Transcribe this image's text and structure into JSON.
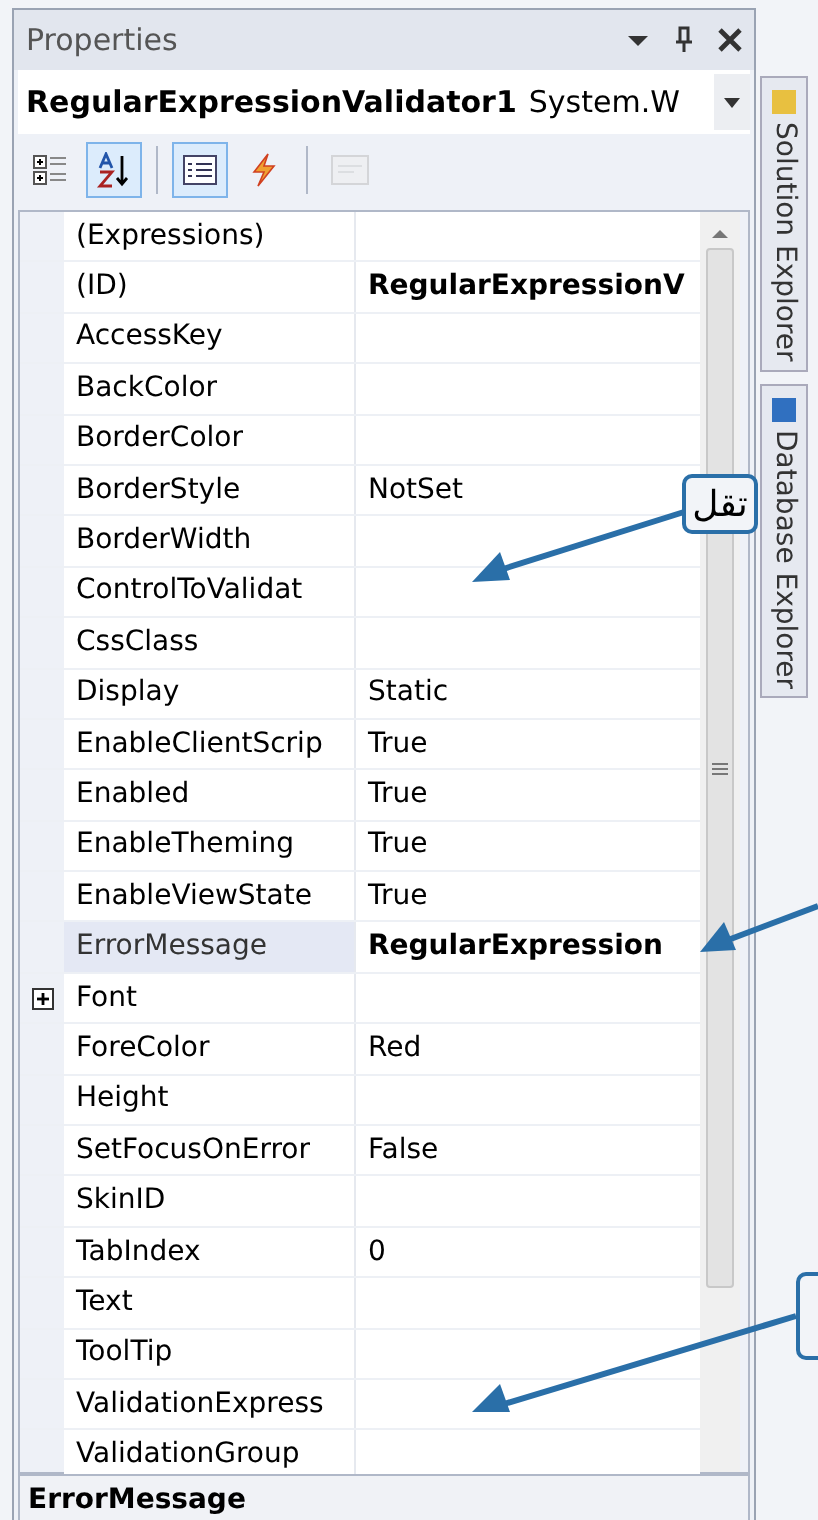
{
  "panel": {
    "title": "Properties",
    "object_selector": {
      "name": "RegularExpressionValidator1",
      "type": "System.W"
    },
    "toolbar": [
      {
        "kind": "categorized",
        "selected": false,
        "disabled": false
      },
      {
        "kind": "alphabetical",
        "selected": true,
        "disabled": false
      },
      {
        "kind": "properties",
        "selected": true,
        "disabled": false
      },
      {
        "kind": "events",
        "selected": false,
        "disabled": false
      },
      {
        "kind": "property_pages",
        "selected": false,
        "disabled": true
      }
    ],
    "properties": [
      {
        "name": "(Expressions)",
        "selected": false
      },
      {
        "name": "(ID)",
        "value": "RegularExpressionV",
        "bold": true,
        "selected": false
      },
      {
        "name": "AccessKey",
        "selected": false
      },
      {
        "name": "BackColor",
        "selected": false
      },
      {
        "name": "BorderColor",
        "selected": false
      },
      {
        "name": "BorderStyle",
        "value": "NotSet",
        "bold": false,
        "selected": false
      },
      {
        "name": "BorderWidth",
        "selected": false
      },
      {
        "name": "ControlToValidat",
        "selected": false
      },
      {
        "name": "CssClass",
        "selected": false
      },
      {
        "name": "Display",
        "value": "Static",
        "bold": false,
        "selected": false
      },
      {
        "name": "EnableClientScrip",
        "value": "True",
        "bold": false,
        "selected": false
      },
      {
        "name": "Enabled",
        "value": "True",
        "bold": false,
        "selected": false
      },
      {
        "name": "EnableTheming",
        "value": "True",
        "bold": false,
        "selected": false
      },
      {
        "name": "EnableViewState",
        "value": "True",
        "bold": false,
        "selected": false
      },
      {
        "name": "ErrorMessage",
        "value": "RegularExpression",
        "bold": true,
        "selected": true
      },
      {
        "name": "Font",
        "selected": false,
        "expanded": false
      },
      {
        "name": "ForeColor",
        "value": "Red",
        "bold": false,
        "selected": false
      },
      {
        "name": "Height",
        "selected": false
      },
      {
        "name": "SetFocusOnError",
        "value": "False",
        "bold": false,
        "selected": false
      },
      {
        "name": "SkinID",
        "selected": false
      },
      {
        "name": "TabIndex",
        "value": "0",
        "bold": false,
        "selected": false
      },
      {
        "name": "Text",
        "selected": false
      },
      {
        "name": "ToolTip",
        "selected": false
      },
      {
        "name": "ValidationExpress",
        "selected": false
      },
      {
        "name": "ValidationGroup",
        "selected": false
      }
    ],
    "description": "ErrorMessage"
  },
  "side_tabs": [
    {
      "label": "Solution Explorer"
    },
    {
      "label": "Database Explorer"
    }
  ],
  "callouts": [
    {
      "text": "تقل"
    }
  ]
}
